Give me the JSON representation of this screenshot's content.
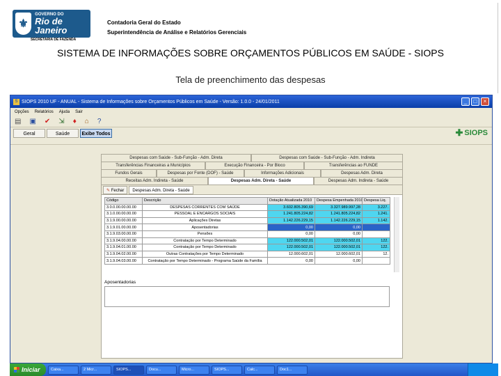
{
  "slide": {
    "logo": {
      "line1": "GOVERNO DO",
      "line2": "Rio de Janeiro",
      "sub": "SECRETARIA DE FAZENDA"
    },
    "org_line1": "Contadoria Geral do Estado",
    "org_line2": "Superintendência de Análise e Relatórios Gerenciais",
    "title": "SISTEMA DE INFORMAÇÕES SOBRE ORÇAMENTOS PÚBLICOS EM SAÚDE - SIOPS",
    "subtitle": "Tela de preenchimento das despesas"
  },
  "window": {
    "title": "SIOPS 2010 UF - ANUAL - Sistema de Informações sobre Orçamentos Públicos em Saúde - Versão: 1.0.0 - 24/01/2011",
    "menu": [
      "Opções",
      "Relatórios",
      "Ajuda",
      "Sair"
    ],
    "toolbar_icons": [
      "print-icon",
      "save-icon",
      "check-icon",
      "export-icon",
      "pin-icon",
      "home-icon",
      "help-icon"
    ],
    "nav": [
      {
        "label": "Geral",
        "selected": false
      },
      {
        "label": "Saúde",
        "selected": false
      },
      {
        "label": "Exibe Todos",
        "selected": true
      }
    ],
    "brand": "SIOPS"
  },
  "tabs": {
    "row1": [
      "Despesas com Saúde - Sub-Função - Adm. Direta",
      "Despesas com Saúde - Sub-Função - Adm. Indireta"
    ],
    "row2": [
      "Transferências Financeiras a Municípios",
      "Execução Financeira - Por Bloco",
      "Transferências ao FUNDE"
    ],
    "row3": [
      "Fundos Gerais",
      "Despesas por Fonte (DOF) - Saúde",
      "Informações Adicionais",
      "Despesas Adm. Direta"
    ],
    "row4": [
      "Receitas Adm. Indireta - Saúde",
      "Despesas Adm. Direta - Saúde",
      "Despesas Adm. Indireta - Saúde"
    ],
    "subtabs": [
      "Fechar",
      "Despesas Adm. Direta - Saúde"
    ]
  },
  "table": {
    "headers": [
      "Código",
      "Descrição",
      "Dotação Atualizada 2010",
      "Despesa Empenhada 2010",
      "Despesa Liq."
    ],
    "rows": [
      {
        "code": "3.0.0.00.00.00.00",
        "desc": "DESPESAS CORRENTES COM SAÚDE",
        "v1": "3.602.805.390,69",
        "v2": "3.327.989.997,28",
        "v3": "3.227.",
        "state": "hl"
      },
      {
        "code": "3.1.0.00.00.00.00",
        "desc": "PESSOAL E ENCARGOS SOCIAIS",
        "v1": "1.241.805.224,82",
        "v2": "1.241.805.224,82",
        "v3": "1.241.",
        "state": "hl"
      },
      {
        "code": "3.1.9.00.00.00.00",
        "desc": "Aplicações Diretas",
        "v1": "1.142.226.229,15",
        "v2": "1.142.226.229,15",
        "v3": "1.142.",
        "state": "hl"
      },
      {
        "code": "3.1.9.01.00.00.00",
        "desc": "Aposentadorias",
        "v1": "0,00",
        "v2": "0,00",
        "v3": "",
        "state": "sel"
      },
      {
        "code": "3.1.9.03.00.00.00",
        "desc": "Pensões",
        "v1": "0,00",
        "v2": "0,00",
        "v3": "",
        "state": ""
      },
      {
        "code": "3.1.9.04.00.00.00",
        "desc": "Contratação por Tempo Determinado",
        "v1": "122.000.502,01",
        "v2": "122.000.502,01",
        "v3": "122.",
        "state": "hl"
      },
      {
        "code": "3.1.9.04.01.00.00",
        "desc": "Contratação por Tempo Determinado",
        "v1": "122.000.502,01",
        "v2": "122.000.502,01",
        "v3": "122.",
        "state": "hl"
      },
      {
        "code": "3.1.9.04.02.00.00",
        "desc": "Outras Contratações por Tempo Determinado",
        "v1": "12.000.602,01",
        "v2": "12.000.602,01",
        "v3": "12.",
        "state": ""
      },
      {
        "code": "3.1.9.04.03.00.00",
        "desc": "Contratação por Tempo Determinado - Programa Saúde da Família",
        "v1": "0,00",
        "v2": "0,00",
        "v3": "",
        "state": ""
      }
    ]
  },
  "aposentadorias_label": "Aposentadorias",
  "taskbar": {
    "start": "Iniciar",
    "tasks": [
      "Caixa...",
      "2 Micr...",
      "SIOPS...",
      "Docu...",
      "Micro...",
      "SIOPS...",
      "Calc...",
      "Doc1..."
    ]
  }
}
